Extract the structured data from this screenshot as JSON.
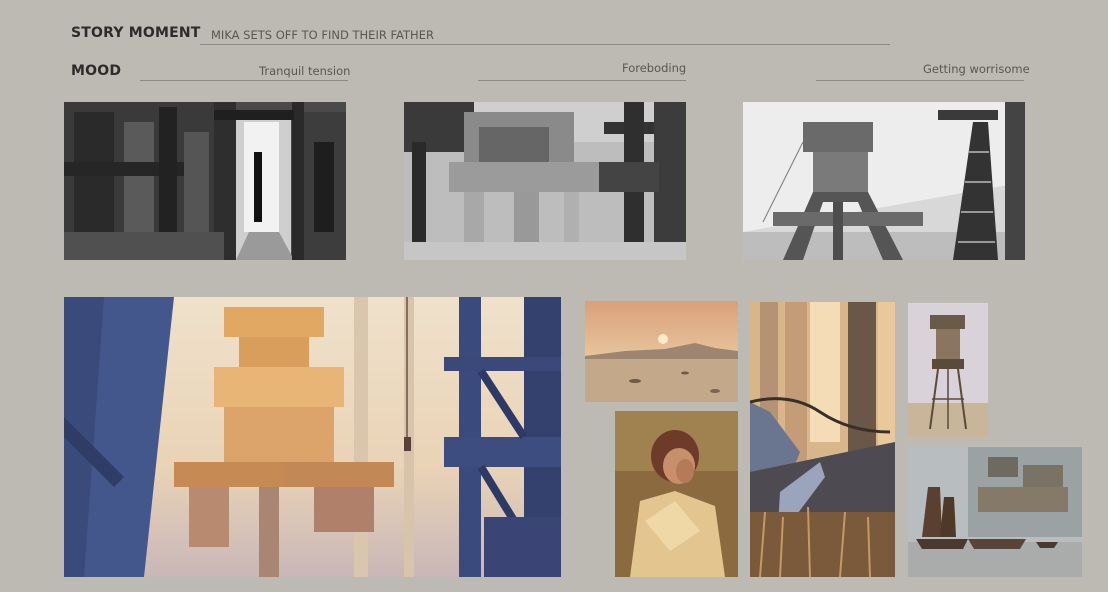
{
  "story_moment": {
    "label": "STORY MOMENT",
    "value": "MIKA SETS OFF TO FIND THEIR FATHER"
  },
  "mood": {
    "label": "MOOD",
    "items": [
      "Tranquil tension",
      "Foreboding",
      "Getting worrisome"
    ]
  },
  "palette": {
    "background": "#bdb9b3",
    "ink": "#2d2c2a",
    "rule": "#8e8a84"
  },
  "thumbnails": [
    {
      "name": "value-sketch-doorway",
      "tone": "grayscale"
    },
    {
      "name": "value-sketch-machinery",
      "tone": "grayscale"
    },
    {
      "name": "value-sketch-tower",
      "tone": "grayscale"
    },
    {
      "name": "keyframe-crane-tower",
      "tone": "warm-blue"
    },
    {
      "name": "reference-desert-sunset",
      "tone": "warm"
    },
    {
      "name": "reference-forest-stream",
      "tone": "warm"
    },
    {
      "name": "reference-stilt-tower",
      "tone": "pastel"
    },
    {
      "name": "reference-figure-portrait",
      "tone": "warm"
    },
    {
      "name": "reference-harbor-junks",
      "tone": "cool"
    }
  ]
}
